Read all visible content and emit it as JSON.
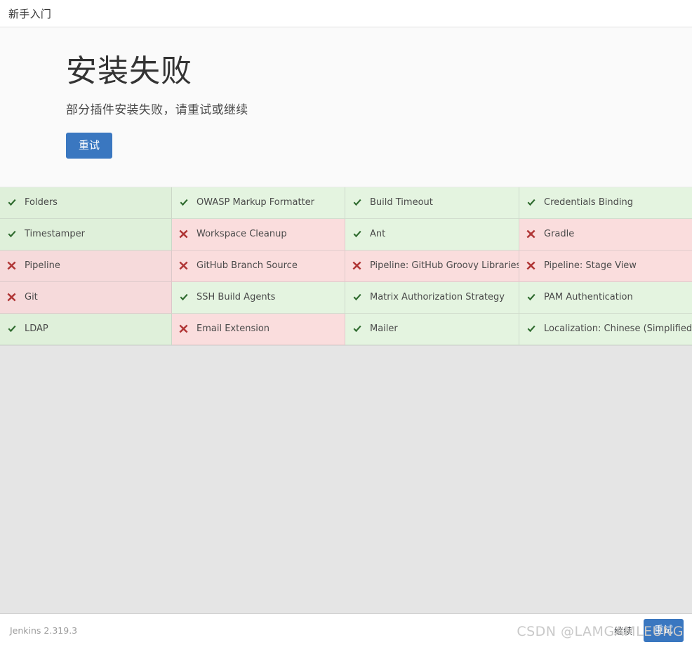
{
  "header": {
    "title": "新手入门"
  },
  "intro": {
    "title": "安装失败",
    "subtitle": "部分插件安装失败，请重试或继续",
    "retry_label": "重试"
  },
  "icons": {
    "success": "check-icon",
    "failure": "cross-icon"
  },
  "colors": {
    "primary_button": "#3a77c0",
    "success_bg": "#dff0da",
    "failure_bg": "#f6dadb",
    "success_icon": "#2f6b2f",
    "failure_icon": "#b03636",
    "page_bg": "#e5e5e5"
  },
  "plugins": [
    {
      "name": "Folders",
      "status": "success"
    },
    {
      "name": "OWASP Markup Formatter",
      "status": "success"
    },
    {
      "name": "Build Timeout",
      "status": "success"
    },
    {
      "name": "Credentials Binding",
      "status": "success"
    },
    {
      "name": "Timestamper",
      "status": "success"
    },
    {
      "name": "Workspace Cleanup",
      "status": "failure"
    },
    {
      "name": "Ant",
      "status": "success"
    },
    {
      "name": "Gradle",
      "status": "failure"
    },
    {
      "name": "Pipeline",
      "status": "failure"
    },
    {
      "name": "GitHub Branch Source",
      "status": "failure"
    },
    {
      "name": "Pipeline: GitHub Groovy Libraries",
      "status": "failure"
    },
    {
      "name": "Pipeline: Stage View",
      "status": "failure"
    },
    {
      "name": "Git",
      "status": "failure"
    },
    {
      "name": "SSH Build Agents",
      "status": "success"
    },
    {
      "name": "Matrix Authorization Strategy",
      "status": "success"
    },
    {
      "name": "PAM Authentication",
      "status": "success"
    },
    {
      "name": "LDAP",
      "status": "success"
    },
    {
      "name": "Email Extension",
      "status": "failure"
    },
    {
      "name": "Mailer",
      "status": "success"
    },
    {
      "name": "Localization: Chinese (Simplified)",
      "status": "success"
    }
  ],
  "footer": {
    "version": "Jenkins 2.319.3",
    "continue_label": "继续",
    "retry_label": "重试"
  },
  "watermark": {
    "text": "CSDN @LAMGAMLEUNG"
  }
}
